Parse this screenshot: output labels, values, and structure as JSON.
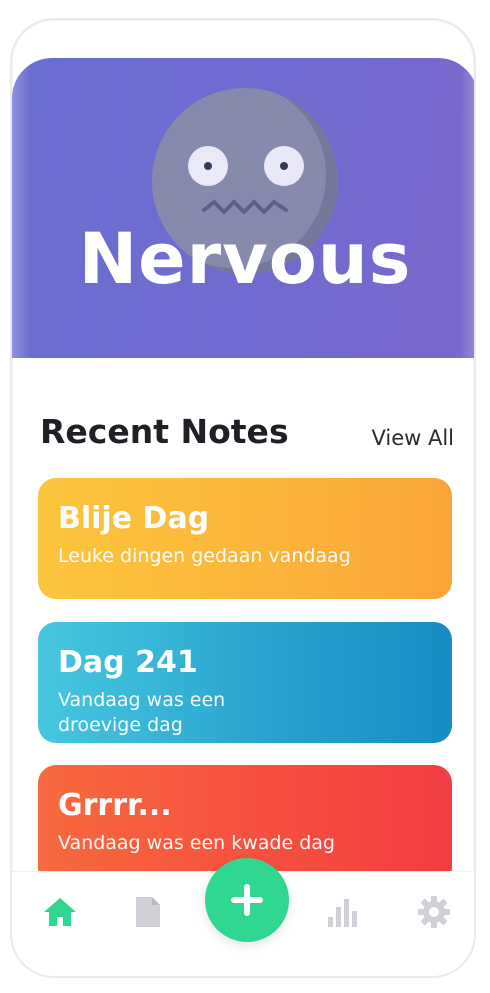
{
  "mood": {
    "label": "Nervous",
    "face_icon": "nervous-face-icon",
    "background": "#6f6bd0"
  },
  "recent_notes": {
    "title": "Recent Notes",
    "view_all": "View All",
    "items": [
      {
        "title": "Blije Dag",
        "description": "Leuke dingen gedaan vandaag",
        "color": "#fbb53a"
      },
      {
        "title": "Dag 241",
        "description": "Vandaag was een droevige dag",
        "color": "#2aa3cf"
      },
      {
        "title": "Grrrr...",
        "description": "Vandaag was een kwade dag",
        "color": "#f54f3f"
      }
    ]
  },
  "bottom_nav": {
    "items": [
      {
        "icon": "home-icon",
        "active": true
      },
      {
        "icon": "document-icon",
        "active": false
      },
      {
        "icon": "add-icon",
        "active": false
      },
      {
        "icon": "chart-icon",
        "active": false
      },
      {
        "icon": "settings-icon",
        "active": false
      }
    ],
    "accent": "#2fd790"
  }
}
